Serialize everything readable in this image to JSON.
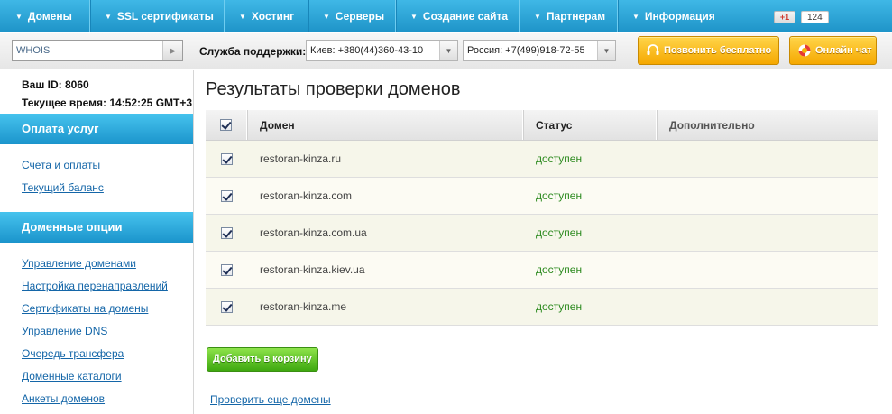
{
  "nav": {
    "items": [
      {
        "label": "Домены"
      },
      {
        "label": "SSL сертификаты"
      },
      {
        "label": "Хостинг"
      },
      {
        "label": "Серверы"
      },
      {
        "label": "Создание сайта"
      },
      {
        "label": "Партнерам"
      },
      {
        "label": "Информация"
      }
    ],
    "gplus_label": "+1",
    "gplus_count": "124"
  },
  "toolbar": {
    "whois_value": "WHOIS",
    "support_label": "Служба поддержки:",
    "phone_kiev": "Киев: +380(44)360-43-10",
    "phone_russia": "Россия: +7(499)918-72-55",
    "call_free_label": "Позвонить бесплатно",
    "online_chat_label": "Онлайн чат"
  },
  "sidebar": {
    "user_id": "Ваш ID: 8060",
    "current_time": "Текущее время: 14:52:25 GMT+3",
    "payment_heading": "Оплата услуг",
    "payment_links": [
      "Счета и оплаты",
      "Текущий баланс"
    ],
    "domain_heading": "Доменные опции",
    "domain_links": [
      "Управление доменами",
      "Настройка перенаправлений",
      "Сертификаты на домены",
      "Управление DNS",
      "Очередь трансфера",
      "Доменные каталоги",
      "Анкеты доменов"
    ]
  },
  "main": {
    "title": "Результаты проверки доменов",
    "columns": {
      "domain": "Домен",
      "status": "Статус",
      "extra": "Дополнительно"
    },
    "rows": [
      {
        "domain": "restoran-kinza.ru",
        "status": "доступен",
        "checked": true
      },
      {
        "domain": "restoran-kinza.com",
        "status": "доступен",
        "checked": true
      },
      {
        "domain": "restoran-kinza.com.ua",
        "status": "доступен",
        "checked": true
      },
      {
        "domain": "restoran-kinza.kiev.ua",
        "status": "доступен",
        "checked": true
      },
      {
        "domain": "restoran-kinza.me",
        "status": "доступен",
        "checked": true
      }
    ],
    "add_to_cart_label": "Добавить в корзину",
    "check_more_label": "Проверить еще домены"
  },
  "colors": {
    "nav_blue": "#2aa6db",
    "status_green": "#2c8a1f",
    "button_orange": "#f5a800",
    "button_green": "#3ea80f",
    "link_blue": "#1466a8"
  }
}
